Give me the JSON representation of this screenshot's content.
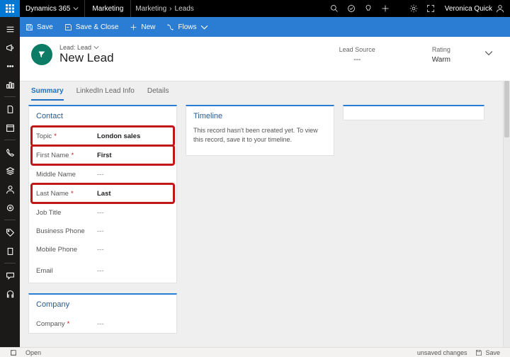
{
  "topbar": {
    "brand": "Dynamics 365",
    "app": "Marketing",
    "breadcrumb1": "Marketing",
    "breadcrumb2": "Leads",
    "username": "Veronica Quick"
  },
  "commands": {
    "save": "Save",
    "saveclose": "Save & Close",
    "new": "New",
    "flows": "Flows"
  },
  "record": {
    "type": "Lead: Lead",
    "title": "New Lead",
    "meta": {
      "leadsource_label": "Lead Source",
      "leadsource_value": "---",
      "rating_label": "Rating",
      "rating_value": "Warm"
    }
  },
  "tabs": {
    "summary": "Summary",
    "linkedin": "LinkedIn Lead Info",
    "details": "Details"
  },
  "contact": {
    "heading": "Contact",
    "fields": {
      "topic_label": "Topic",
      "topic_value": "London sales",
      "firstname_label": "First Name",
      "firstname_value": "First",
      "middlename_label": "Middle Name",
      "middlename_value": "---",
      "lastname_label": "Last Name",
      "lastname_value": "Last",
      "jobtitle_label": "Job Title",
      "jobtitle_value": "---",
      "bphone_label": "Business Phone",
      "bphone_value": "---",
      "mphone_label": "Mobile Phone",
      "mphone_value": "---",
      "email_label": "Email",
      "email_value": "---"
    }
  },
  "company": {
    "heading": "Company",
    "fields": {
      "company_label": "Company",
      "company_value": "---"
    }
  },
  "timeline": {
    "heading": "Timeline",
    "body": "This record hasn't been created yet. To view this record, save it to your timeline."
  },
  "status": {
    "open": "Open",
    "unsaved": "unsaved changes",
    "save": "Save"
  }
}
